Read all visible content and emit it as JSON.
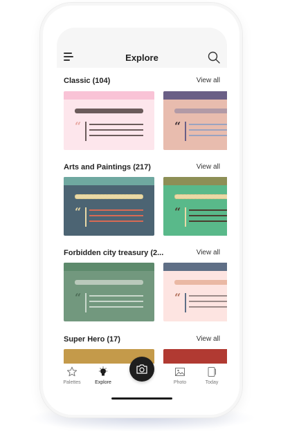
{
  "header": {
    "title": "Explore"
  },
  "sections": [
    {
      "title": "Classic",
      "count": "(104)",
      "view_all": "View all"
    },
    {
      "title": "Arts and Paintings",
      "count": "(217)",
      "view_all": "View all"
    },
    {
      "title": "Forbidden city treasury",
      "count": "(2...",
      "view_all": "View all"
    },
    {
      "title": "Super Hero",
      "count": "(17)",
      "view_all": "View all"
    }
  ],
  "nav": {
    "palettes": "Palettes",
    "explore": "Explore",
    "photo": "Photo",
    "today": "Today"
  },
  "colors": {
    "classic_1": {
      "bg": "#fde6ec",
      "band": "#f9c3d6",
      "accent": "#6b5b5b",
      "quote": "#e7a6a0"
    },
    "classic_2": {
      "bg": "#e8bcae",
      "band": "#6a5f86",
      "accent": "#b29aa6",
      "quote": "#3b2e34"
    },
    "arts_1": {
      "bg": "#4c6473",
      "band": "#6fa8a0",
      "accent": "#ead9a6",
      "lines": "#d86a54"
    },
    "arts_2": {
      "bg": "#59b98a",
      "band": "#8d8f56",
      "accent": "#ead9a6",
      "lines": "#4b3c2e"
    },
    "forbidden_1": {
      "bg": "#72987e",
      "band": "#5d8a6c",
      "accent": "#b9c9bb",
      "lines": "#c9d8cc"
    },
    "forbidden_2": {
      "bg": "#fde4e1",
      "band": "#5f6f86",
      "accent": "#eab8a4",
      "quote": "#b4735e"
    },
    "hero_1": "#c49a4a",
    "hero_2": "#b13a32"
  }
}
